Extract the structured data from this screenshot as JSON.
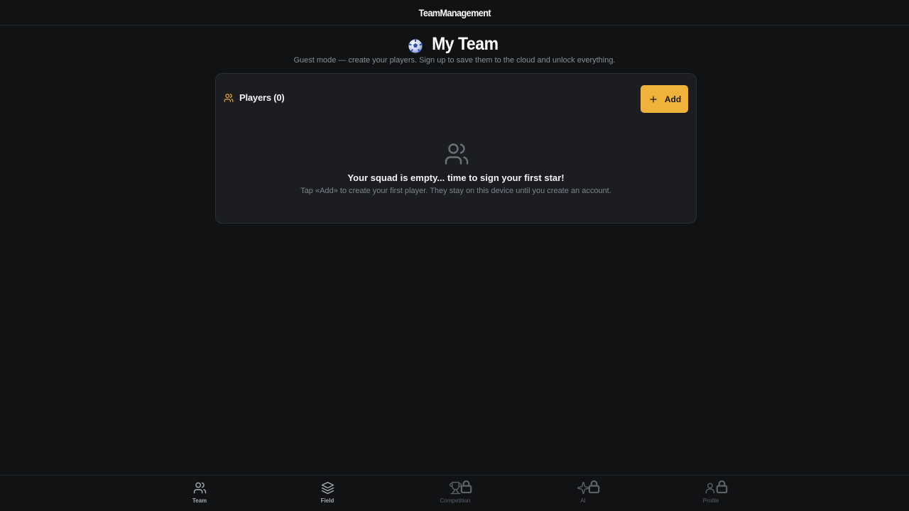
{
  "header": {
    "brand": "TeamManagement"
  },
  "page": {
    "title": "My Team",
    "subtitle": "Guest mode — create your players. Sign up to save them to the cloud and unlock everything."
  },
  "players_card": {
    "label": "Players (0)",
    "add_label": "Add",
    "empty_title": "Your squad is empty... time to sign your first star!",
    "empty_description": "Tap «Add» to create your first player. They stay on this device until you create an account."
  },
  "bottom_nav": {
    "items": [
      {
        "label": "Team",
        "icon": "users-icon",
        "active": true
      },
      {
        "label": "Field",
        "icon": "layers-icon",
        "active": true
      },
      {
        "label": "Competition",
        "icon": "trophy-icon",
        "locked": true
      },
      {
        "label": "AI",
        "icon": "sparkles-icon",
        "locked": true
      },
      {
        "label": "Profile",
        "icon": "user-icon",
        "locked": true
      }
    ]
  },
  "colors": {
    "background": "#111214",
    "card": "#1b1d21",
    "accent": "#efb23b",
    "muted_text": "#8a8f98"
  }
}
